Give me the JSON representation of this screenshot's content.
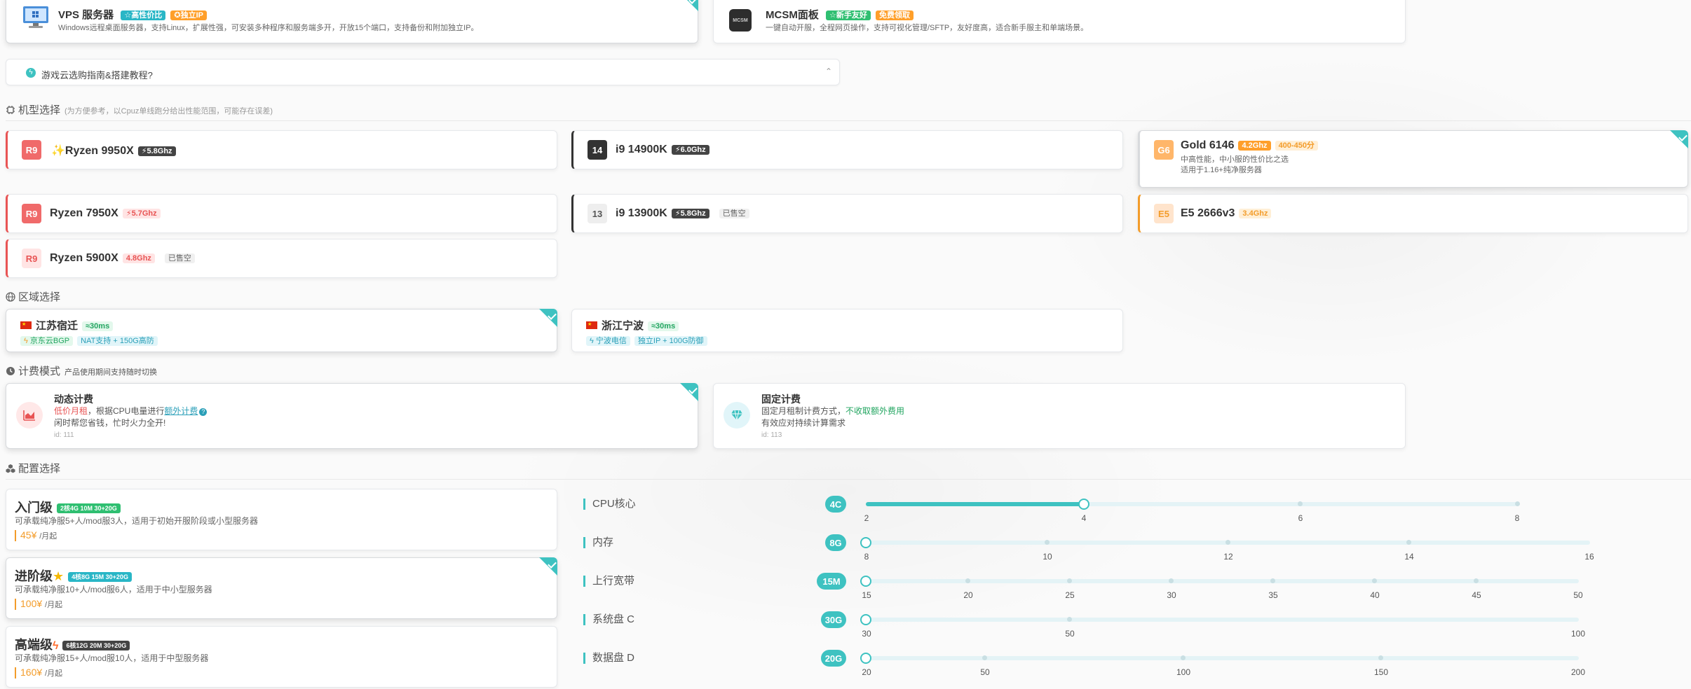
{
  "server_types": [
    {
      "name": "VPS 服务器",
      "tags": [
        "☆高性价比",
        "✪独立IP"
      ],
      "desc": "Windows远程桌面服务器，支持Linux，扩展性强，可安装多种程序和服务端多开，开放15个端口，支持备份和附加独立IP。"
    },
    {
      "name": "MCSM面板",
      "tags": [
        "☆新手友好",
        "免费领取"
      ],
      "desc": "一键自动开服，全程网页操作，支持可视化管理/SFTP，友好度高，适合新手服主和单端场景。"
    }
  ],
  "guide": {
    "text": "游戏云选购指南&搭建教程?"
  },
  "model_section": {
    "title": "机型选择",
    "sub": "(为方便参考，以Cpuz单线跑分给出性能范围，可能存在误差)"
  },
  "cpus": [
    {
      "badge": "R9",
      "name": "Ryzen 9950X",
      "freq": "⚡5.8Ghz",
      "star": "✨"
    },
    {
      "badge": "14",
      "name": "i9 14900K",
      "freq": "⚡6.0Ghz"
    },
    {
      "badge": "G6",
      "name": "Gold 6146",
      "freq": "4.2Ghz",
      "extra": "400-450分",
      "desc1": "中高性能，中小服的性价比之选",
      "desc2": "适用于1.16+纯净服务器"
    },
    {
      "badge": "R9",
      "name": "Ryzen 7950X",
      "freq": "⚡5.7Ghz"
    },
    {
      "badge": "13",
      "name": "i9 13900K",
      "freq": "⚡5.8Ghz",
      "soldout": "已售空"
    },
    {
      "badge": "E5",
      "name": "E5 2666v3",
      "freq": "3.4Ghz"
    },
    {
      "badge": "R9",
      "name": "Ryzen 5900X",
      "freq": "4.8Ghz",
      "soldout": "已售空"
    }
  ],
  "region_section": {
    "title": "区域选择"
  },
  "regions": [
    {
      "name": "江苏宿迁",
      "ping": "≈30ms",
      "line": "京东云BGP",
      "feature": "NAT支持 + 150G高防"
    },
    {
      "name": "浙江宁波",
      "ping": "≈30ms",
      "line": "宁波电信",
      "feature": "独立IP + 100G防御"
    }
  ],
  "billing_section": {
    "title": "计费模式",
    "sub": "产品使用期间支持随时切换"
  },
  "billing": [
    {
      "title": "动态计费",
      "line1_a": "低价月租",
      "line1_b": "，根据CPU电量进行",
      "line1_link": "额外计费",
      "line2": "闲时帮您省钱，忙时火力全开!",
      "id": "id: 111"
    },
    {
      "title": "固定计费",
      "line1_a": "固定月租制计费方式，",
      "line1_b": "不收取额外费用",
      "line2": "有效应对持续计算需求",
      "id": "id: 113"
    }
  ],
  "config_section": {
    "title": "配置选择"
  },
  "plans": [
    {
      "title": "入门级",
      "tag": "2核4G 10M 30+20G",
      "desc": "可承载纯净服5+人/mod服3人，适用于初始开服阶段或小型服务器",
      "price": "45¥",
      "unit": "/月起"
    },
    {
      "title": "进阶级",
      "tag": "4核8G 15M 30+20G",
      "desc": "可承载纯净服10+人/mod服6人，适用于中小型服务器",
      "price": "100¥",
      "unit": "/月起"
    },
    {
      "title": "高端级",
      "tag": "6核12G 20M 30+20G",
      "desc": "可承载纯净服15+人/mod服10人，适用于中型服务器",
      "price": "160¥",
      "unit": "/月起"
    }
  ],
  "sliders": [
    {
      "label": "CPU核心",
      "value": "4C",
      "ticks": [
        "2",
        "4",
        "6",
        "8"
      ],
      "level": 0.333
    },
    {
      "label": "内存",
      "value": "8G",
      "ticks": [
        "8",
        "10",
        "12",
        "14",
        "16"
      ],
      "level": 0
    },
    {
      "label": "上行宽带",
      "value": "15M",
      "ticks": [
        "15",
        "20",
        "25",
        "30",
        "35",
        "40",
        "45",
        "50"
      ],
      "level": 0
    },
    {
      "label": "系统盘 C",
      "value": "30G",
      "ticks": [
        "30",
        "50",
        "100"
      ],
      "level": 0
    },
    {
      "label": "数据盘 D",
      "value": "20G",
      "ticks": [
        "20",
        "50",
        "100",
        "150",
        "200"
      ],
      "level": 0
    }
  ],
  "colors": {
    "accent": "#3ec2c1",
    "price": "#f39c2a",
    "red": "#e85454"
  }
}
